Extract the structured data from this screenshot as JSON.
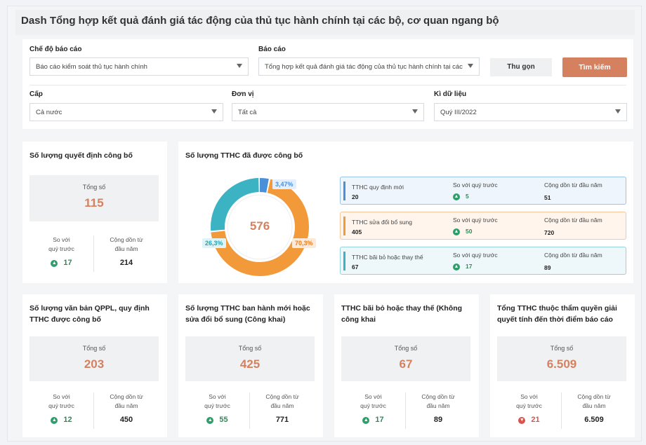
{
  "title": "Dash Tổng hợp kết quả đánh giá tác động của thủ tục hành chính tại các bộ, cơ quan ngang bộ",
  "filters": {
    "report_mode": {
      "label": "Chế độ báo cáo",
      "value": "Báo cáo kiểm soát thủ tục hành chính"
    },
    "report": {
      "label": "Báo cáo",
      "value": "Tổng hợp kết quả đánh giá tác động của thủ tục hành chính tại các"
    },
    "collapse_button": "Thu gọn",
    "search_button": "Tìm kiếm",
    "level": {
      "label": "Cấp",
      "value": "Cả nước"
    },
    "unit": {
      "label": "Đơn vị",
      "value": "Tất cả"
    },
    "period": {
      "label": "Kì dữ liệu",
      "value": "Quý III/2022"
    }
  },
  "card_decisions": {
    "title": "Số lượng quyết định công bố",
    "total_label": "Tổng số",
    "total": "115",
    "compare_label_1": "So với",
    "compare_label_2": "quý trước",
    "compare_value": "17",
    "cumulative_label_1": "Cộng dồn từ",
    "cumulative_label_2": "đầu năm",
    "cumulative_value": "214"
  },
  "card_tthc": {
    "title": "Số lượng TTHC đã được công bố",
    "total": "576",
    "donut": {
      "segments": [
        {
          "label": "3,47%",
          "percent": 3.47,
          "color": "#4a90d9"
        },
        {
          "label": "70,3%",
          "percent": 70.3,
          "color": "#f29a3a"
        },
        {
          "label": "26,3%",
          "percent": 26.3,
          "color": "#3bb3c3"
        }
      ]
    },
    "rows": [
      {
        "name": "TTHC quy định mới",
        "value": "20",
        "compare_label": "So với quý trước",
        "compare": "5",
        "cum_label": "Cộng dồn từ đầu năm",
        "cum": "51",
        "color": "#4a90d9",
        "bg": "#eef5fc",
        "border": "#9cc4ea"
      },
      {
        "name": "TTHC sửa đổi bổ sung",
        "value": "405",
        "compare_label": "So với quý trước",
        "compare": "50",
        "cum_label": "Cộng dồn từ đầu năm",
        "cum": "720",
        "color": "#f29a3a",
        "bg": "#fff5ec",
        "border": "#f5c79a"
      },
      {
        "name": "TTHC bãi bỏ hoặc thay thế",
        "value": "67",
        "compare_label": "So với quý trước",
        "compare": "17",
        "cum_label": "Cộng dồn từ đầu năm",
        "cum": "89",
        "color": "#3bb3c3",
        "bg": "#eef8fa",
        "border": "#96d3dc"
      }
    ]
  },
  "bottom_cards": [
    {
      "title_1": "Số lượng văn bản QPPL, quy định",
      "title_2": "TTHC được công bố",
      "total_label": "Tổng số",
      "total": "203",
      "compare_label_1": "So với",
      "compare_label_2": "quý trước",
      "compare_value": "12",
      "trend": "up",
      "cumulative_label_1": "Cộng dồn từ",
      "cumulative_label_2": "đầu năm",
      "cumulative_value": "450"
    },
    {
      "title_1": "Số lượng TTHC ban hành mới hoặc",
      "title_2": "sửa đổi bổ sung (Công khai)",
      "total_label": "Tổng số",
      "total": "425",
      "compare_label_1": "So với",
      "compare_label_2": "quý trước",
      "compare_value": "55",
      "trend": "up",
      "cumulative_label_1": "Cộng dồn từ",
      "cumulative_label_2": "đầu năm",
      "cumulative_value": "771"
    },
    {
      "title_1": "TTHC bãi bỏ hoặc thay thế (Không",
      "title_2": "công khai",
      "total_label": "Tổng số",
      "total": "67",
      "compare_label_1": "So với",
      "compare_label_2": "quý trước",
      "compare_value": "17",
      "trend": "up",
      "cumulative_label_1": "Cộng dồn từ",
      "cumulative_label_2": "đầu năm",
      "cumulative_value": "89"
    },
    {
      "title_1": "Tổng  TTHC thuộc thẩm quyền giải",
      "title_2": "quyết tính đến thời điểm báo cáo",
      "total_label": "Tổng số",
      "total": "6.509",
      "compare_label_1": "So với",
      "compare_label_2": "quý trước",
      "compare_value": "21",
      "trend": "down",
      "cumulative_label_1": "Cộng dồn từ",
      "cumulative_label_2": "đầu năm",
      "cumulative_value": "6.509"
    }
  ]
}
